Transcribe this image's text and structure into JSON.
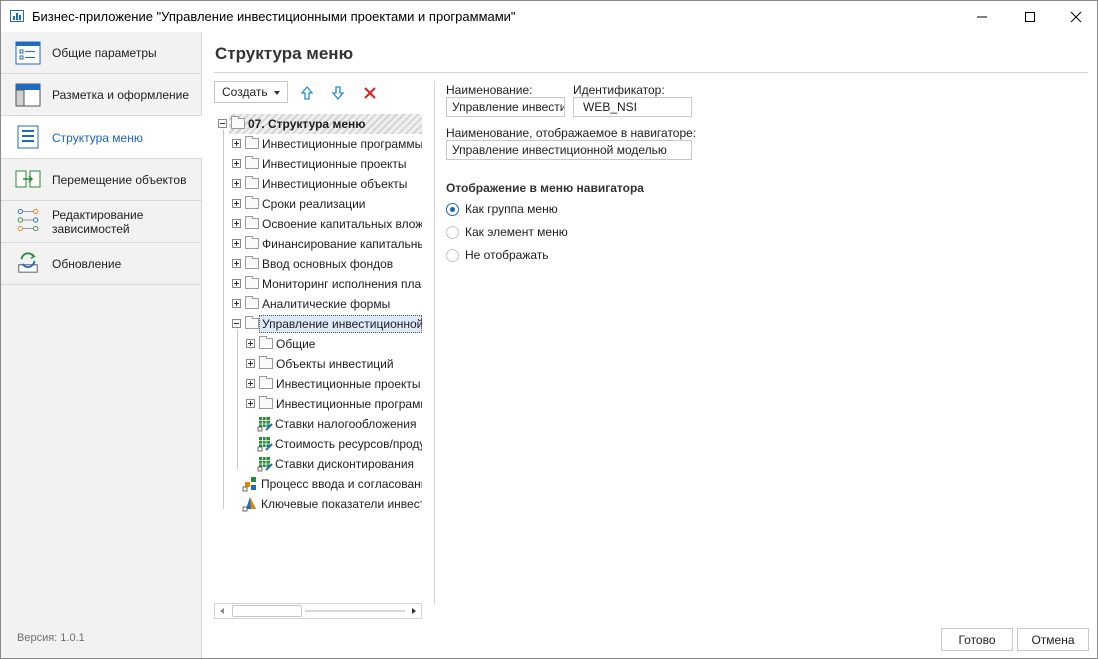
{
  "window": {
    "title": "Бизнес-приложение \"Управление инвестиционными проектами и программами\""
  },
  "sidebar": {
    "items": [
      {
        "label": "Общие параметры",
        "icon": "general-params-icon"
      },
      {
        "label": "Разметка и оформление",
        "icon": "layout-icon"
      },
      {
        "label": "Структура меню",
        "icon": "menu-structure-icon",
        "active": true
      },
      {
        "label": "Перемещение объектов",
        "icon": "move-objects-icon"
      },
      {
        "label": "Редактирование зависимостей",
        "icon": "dependencies-icon"
      },
      {
        "label": "Обновление",
        "icon": "refresh-icon"
      }
    ],
    "version": "Версия: 1.0.1"
  },
  "main": {
    "title": "Структура меню"
  },
  "toolbar": {
    "create_label": "Создать",
    "move_up_icon": "arrow-up-icon",
    "move_down_icon": "arrow-down-icon",
    "delete_icon": "delete-icon"
  },
  "tree": {
    "root": "07. Структура меню",
    "items": [
      "Инвестиционные программы",
      "Инвестиционные проекты",
      "Инвестиционные объекты",
      "Сроки реализации",
      "Освоение капитальных вложен",
      "Финансирование капитальных в",
      "Ввод основных фондов",
      "Мониторинг исполнения планов",
      "Аналитические формы",
      "Управление инвестиционной мо"
    ],
    "children": [
      "Общие",
      "Объекты инвестиций",
      "Инвестиционные проекты",
      "Инвестиционные программы",
      "Ставки налогообложения",
      "Стоимость ресурсов/продукц",
      "Ставки дисконтирования"
    ],
    "tail": [
      "Процесс ввода и согласования д",
      "Ключевые показатели инвести"
    ]
  },
  "form": {
    "name_label": "Наименование:",
    "name_value": "Управление инвестиц",
    "id_label": "Идентификатор:",
    "id_value": "WEB_NSI",
    "nav_name_label": "Наименование, отображаемое в навигаторе:",
    "nav_name_value": "Управление инвестиционной моделью",
    "display_heading": "Отображение в меню навигатора",
    "options": [
      "Как группа меню",
      "Как элемент меню",
      "Не отображать"
    ],
    "selected_option": "Как группа меню"
  },
  "footer": {
    "ok_label": "Готово",
    "cancel_label": "Отмена"
  },
  "colors": {
    "accent": "#1a66b8",
    "delete": "#e02020",
    "arrow": "#1f8fd6",
    "sidebar_bg": "#f2f2f2"
  }
}
